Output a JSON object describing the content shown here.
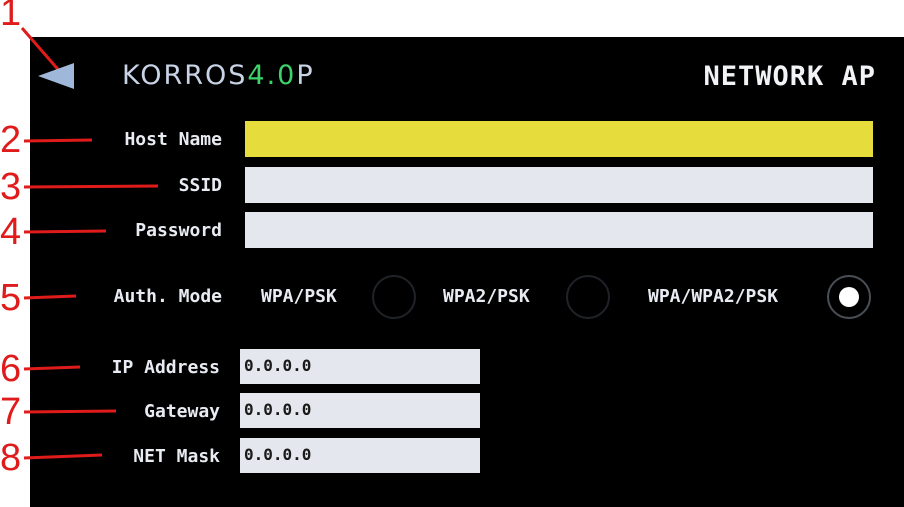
{
  "annotations": [
    "1",
    "2",
    "3",
    "4",
    "5",
    "6",
    "7",
    "8"
  ],
  "header": {
    "logo_part1": "KORROS",
    "logo_part2": "4.0",
    "logo_part3": "P",
    "title": "NETWORK AP",
    "back_icon": "back-arrow-icon"
  },
  "form": {
    "host_name": {
      "label": "Host Name",
      "value": ""
    },
    "ssid": {
      "label": "SSID",
      "value": ""
    },
    "password": {
      "label": "Password",
      "value": ""
    },
    "auth_mode": {
      "label": "Auth. Mode",
      "options": [
        {
          "label": "WPA/PSK",
          "selected": false
        },
        {
          "label": "WPA2/PSK",
          "selected": false
        },
        {
          "label": "WPA/WPA2/PSK",
          "selected": true
        }
      ]
    },
    "ip_address": {
      "label": "IP Address",
      "value": "0.0.0.0"
    },
    "gateway": {
      "label": "Gateway",
      "value": "0.0.0.0"
    },
    "net_mask": {
      "label": "NET Mask",
      "value": "0.0.0.0"
    }
  },
  "colors": {
    "active_field": "#e6dc3c",
    "field": "#e4e7ee",
    "annotation": "#e01b1b",
    "logo_accent": "#3fd26a"
  }
}
